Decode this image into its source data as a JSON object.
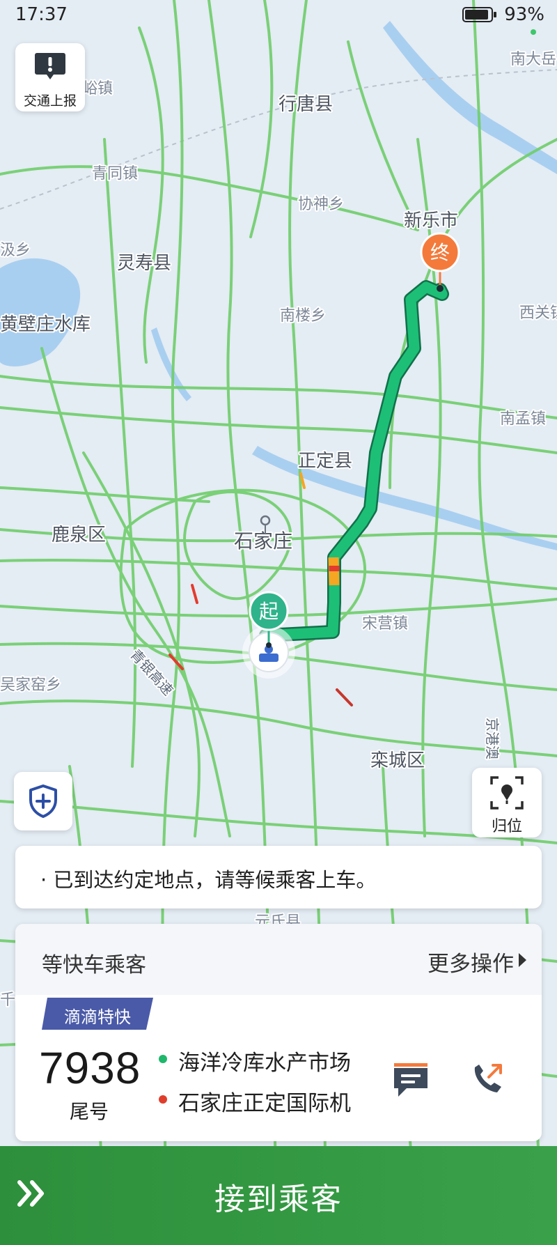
{
  "status_bar": {
    "time": "17:37",
    "battery_percent": "93%",
    "battery_level": 0.93
  },
  "map": {
    "labels": [
      {
        "text": "行唐县",
        "emphasis": true
      },
      {
        "text": "峪镇",
        "emphasis": false
      },
      {
        "text": "南大岳",
        "emphasis": false
      },
      {
        "text": "青同镇",
        "emphasis": false
      },
      {
        "text": "协神乡",
        "emphasis": false
      },
      {
        "text": "新乐市",
        "emphasis": true
      },
      {
        "text": "汲乡",
        "emphasis": false
      },
      {
        "text": "灵寿县",
        "emphasis": true
      },
      {
        "text": "南楼乡",
        "emphasis": false
      },
      {
        "text": "西关镇",
        "emphasis": false
      },
      {
        "text": "黄壁庄水库",
        "emphasis": true
      },
      {
        "text": "南孟镇",
        "emphasis": false
      },
      {
        "text": "正定县",
        "emphasis": true
      },
      {
        "text": "鹿泉区",
        "emphasis": true
      },
      {
        "text": "石家庄",
        "emphasis": true
      },
      {
        "text": "宋营镇",
        "emphasis": false
      },
      {
        "text": "吴家窑乡",
        "emphasis": false
      },
      {
        "text": "青银高速",
        "emphasis": false
      },
      {
        "text": "京港澳",
        "emphasis": false
      },
      {
        "text": "栾城区",
        "emphasis": true
      },
      {
        "text": "元氏县",
        "emphasis": false
      },
      {
        "text": "千亭",
        "emphasis": false
      }
    ],
    "start_marker": "起",
    "end_marker": "终"
  },
  "traffic_report": {
    "label": "交通上报",
    "icon": "exclamation-bubble-icon"
  },
  "safety_button": {
    "icon": "shield-plus-icon"
  },
  "locate_button": {
    "label": "归位",
    "icon": "locate-pin-icon"
  },
  "notice": {
    "text": "· 已到达约定地点，请等候乘客上车。"
  },
  "ride": {
    "status_title": "等快车乘客",
    "more_actions": "更多操作",
    "service_tag": "滴滴特快",
    "tail_number": "7938",
    "tail_label": "尾号",
    "pickup_location": "海洋冷库水产市场",
    "dropoff_location": "石家庄正定国际机",
    "message_icon": "message-icon",
    "call_icon": "phone-call-icon"
  },
  "action": {
    "pickup_label": "接到乘客"
  },
  "colors": {
    "road_green": "#6fce6a",
    "route_green": "#1dbf76",
    "congestion_yellow": "#f5a623",
    "congestion_red": "#e33b2e",
    "start_marker": "#2fb38a",
    "end_marker": "#f47a3c",
    "tag_blue": "#4a5aa8",
    "action_green": "#34993f"
  }
}
